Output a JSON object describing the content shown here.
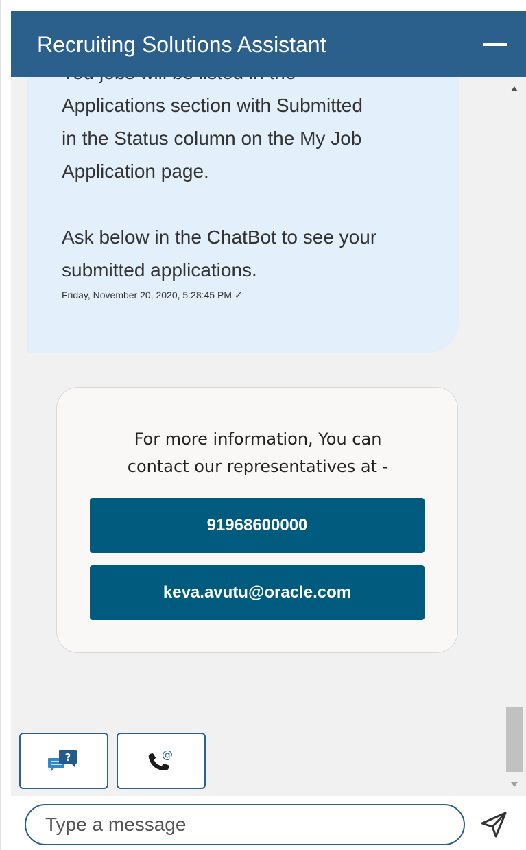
{
  "header": {
    "title": "Recruiting Solutions Assistant",
    "minimize_icon": "minimize-icon"
  },
  "messages": {
    "bot_message": {
      "lines": [
        "You jobs will be listed in the",
        "Applications section with Submitted",
        "in the Status column on the My Job",
        "Application page.",
        "",
        "Ask below in the ChatBot to see your",
        "submitted applications."
      ],
      "timestamp": "Friday, November 20, 2020, 5:28:45 PM ✓"
    },
    "contact_card": {
      "text_lines": [
        "For more information, You can",
        "contact our representatives at -"
      ],
      "phone_button": "91968600000",
      "email_button": "keva.avutu@oracle.com"
    }
  },
  "actions": {
    "faq_icon": "chat-question-icon",
    "contact_icon": "phone-at-icon"
  },
  "composer": {
    "placeholder": "Type a message",
    "send_icon": "send-icon"
  },
  "colors": {
    "header": "#2b5f8c",
    "button": "#005b7f",
    "bubble": "#e4effc",
    "background": "#f1f1f1"
  }
}
